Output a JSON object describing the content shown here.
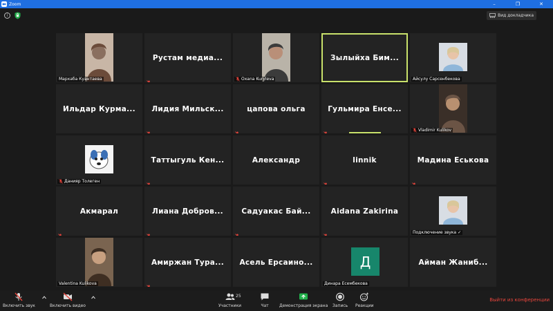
{
  "window": {
    "title": "Zoom"
  },
  "top": {
    "view_label": "Вид докладчика"
  },
  "participants": [
    {
      "name": "Мархаба Куантаева",
      "type": "video",
      "muted": false
    },
    {
      "name": "Рустам медиа...",
      "type": "name",
      "muted": true
    },
    {
      "name": "Oxana Kuryleva",
      "type": "video",
      "muted": true
    },
    {
      "name": "Зылыйха Бим...",
      "type": "name",
      "muted": false,
      "active": true
    },
    {
      "name": "Айсулу Сарсенбекова",
      "type": "photo",
      "muted": false
    },
    {
      "name": "Ильдар Курма...",
      "type": "name",
      "muted": false
    },
    {
      "name": "Лидия Мильск...",
      "type": "name",
      "muted": true
    },
    {
      "name": "цапова ольга",
      "type": "name",
      "muted": true
    },
    {
      "name": "Гульмира Енсе...",
      "type": "name",
      "muted": true,
      "speaking": true
    },
    {
      "name": "Vladimir Kulikov",
      "type": "video",
      "muted": true
    },
    {
      "name": "Данияр Толеген",
      "type": "cartoon",
      "muted": true
    },
    {
      "name": "Таттыгуль Кен...",
      "type": "name",
      "muted": true
    },
    {
      "name": "Александр",
      "type": "name",
      "muted": false
    },
    {
      "name": "linnik",
      "type": "name",
      "muted": true
    },
    {
      "name": "Мадина Еськова",
      "type": "name",
      "muted": true
    },
    {
      "name": "Акмарал",
      "type": "name",
      "muted": true
    },
    {
      "name": "Лиана Добров...",
      "type": "name",
      "muted": true
    },
    {
      "name": "Садуакас Бай...",
      "type": "name",
      "muted": true
    },
    {
      "name": "Aidana Zakirina",
      "type": "name",
      "muted": true
    },
    {
      "name": "Подключение звука",
      "type": "photo",
      "muted": false,
      "connecting": true
    },
    {
      "name": "Valentina Kulikova",
      "type": "video",
      "muted": false
    },
    {
      "name": "Амиржан Тура...",
      "type": "name",
      "muted": true
    },
    {
      "name": "Асель Ерсаино...",
      "type": "name",
      "muted": false
    },
    {
      "name": "Динара Есембекова",
      "type": "letter",
      "letter": "Д",
      "muted": false
    },
    {
      "name": "Айман Жаниб...",
      "type": "name",
      "muted": false
    }
  ],
  "toolbar": {
    "unmute_label": "Включить звук",
    "video_label": "Включить видео",
    "participants_label": "Участники",
    "participants_count": "25",
    "chat_label": "Чат",
    "share_label": "Демонстрация экрана",
    "record_label": "Запись",
    "reactions_label": "Реакции",
    "leave_label": "Выйти из конференции"
  },
  "colors": {
    "accent": "#c9e26b",
    "leave": "#e8453c",
    "titlebar": "#1f6fe0",
    "share": "#21b24b",
    "avatar": "#17866b"
  }
}
